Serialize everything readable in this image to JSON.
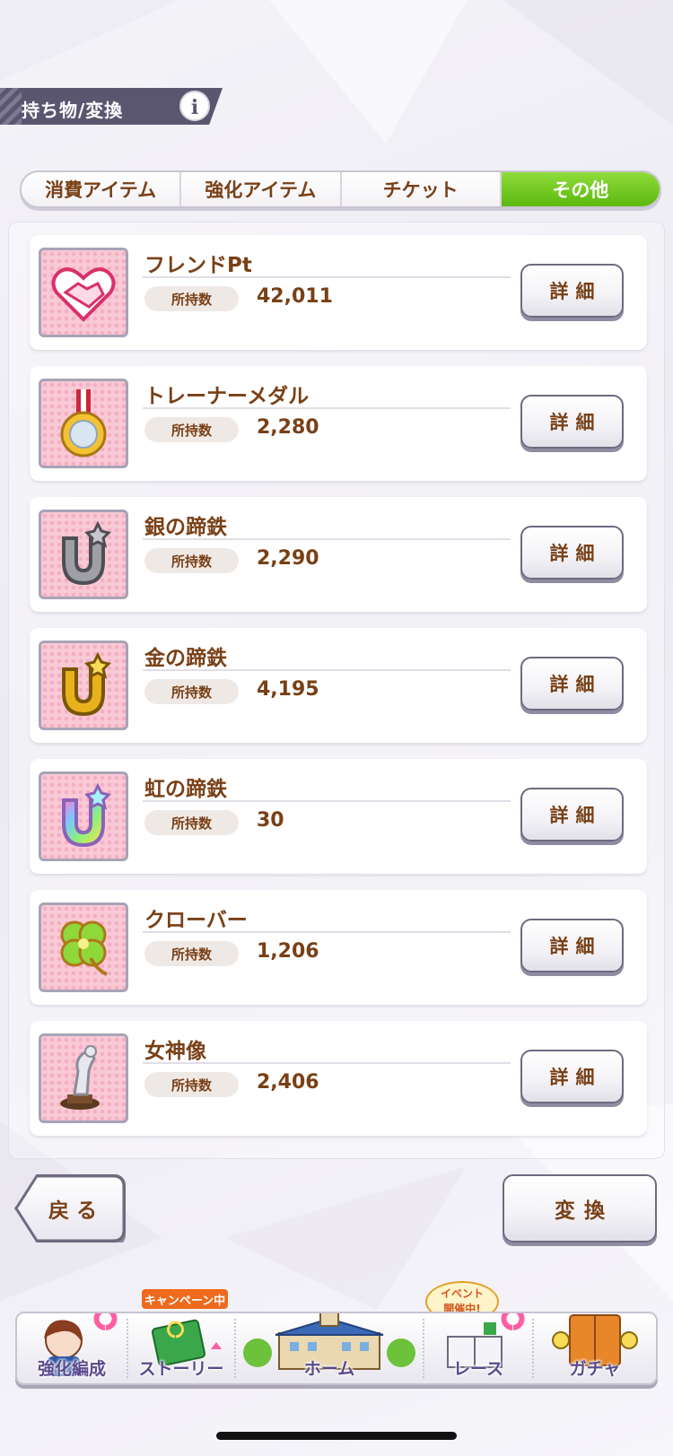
{
  "header": {
    "title": "持ち物/変換",
    "info_label": "i"
  },
  "tabs": [
    {
      "label": "消費アイテム",
      "active": false
    },
    {
      "label": "強化アイテム",
      "active": false
    },
    {
      "label": "チケット",
      "active": false
    },
    {
      "label": "その他",
      "active": true
    }
  ],
  "qty_label": "所持数",
  "detail_label": "詳細",
  "items": [
    {
      "name": "フレンドPt",
      "qty": "42,011",
      "icon": "friend-pt-handshake-icon"
    },
    {
      "name": "トレーナーメダル",
      "qty": "2,280",
      "icon": "trainer-medal-icon"
    },
    {
      "name": "銀の蹄鉄",
      "qty": "2,290",
      "icon": "silver-horseshoe-icon"
    },
    {
      "name": "金の蹄鉄",
      "qty": "4,195",
      "icon": "gold-horseshoe-icon"
    },
    {
      "name": "虹の蹄鉄",
      "qty": "30",
      "icon": "rainbow-horseshoe-icon"
    },
    {
      "name": "クローバー",
      "qty": "1,206",
      "icon": "clover-icon"
    },
    {
      "name": "女神像",
      "qty": "2,406",
      "icon": "goddess-statue-icon"
    }
  ],
  "buttons": {
    "back": "戻る",
    "convert": "変換"
  },
  "nav": {
    "items": [
      {
        "label": "強化編成"
      },
      {
        "label": "ストーリー"
      },
      {
        "label": "ホーム"
      },
      {
        "label": "レース"
      },
      {
        "label": "ガチャ"
      }
    ],
    "campaign_badge": "キャンペーン中",
    "event_badge_line1": "イベント",
    "event_badge_line2": "開催中!"
  },
  "colors": {
    "accent_green": "#5cb80f",
    "text_brown": "#794016",
    "header_bg": "#5a5670"
  }
}
